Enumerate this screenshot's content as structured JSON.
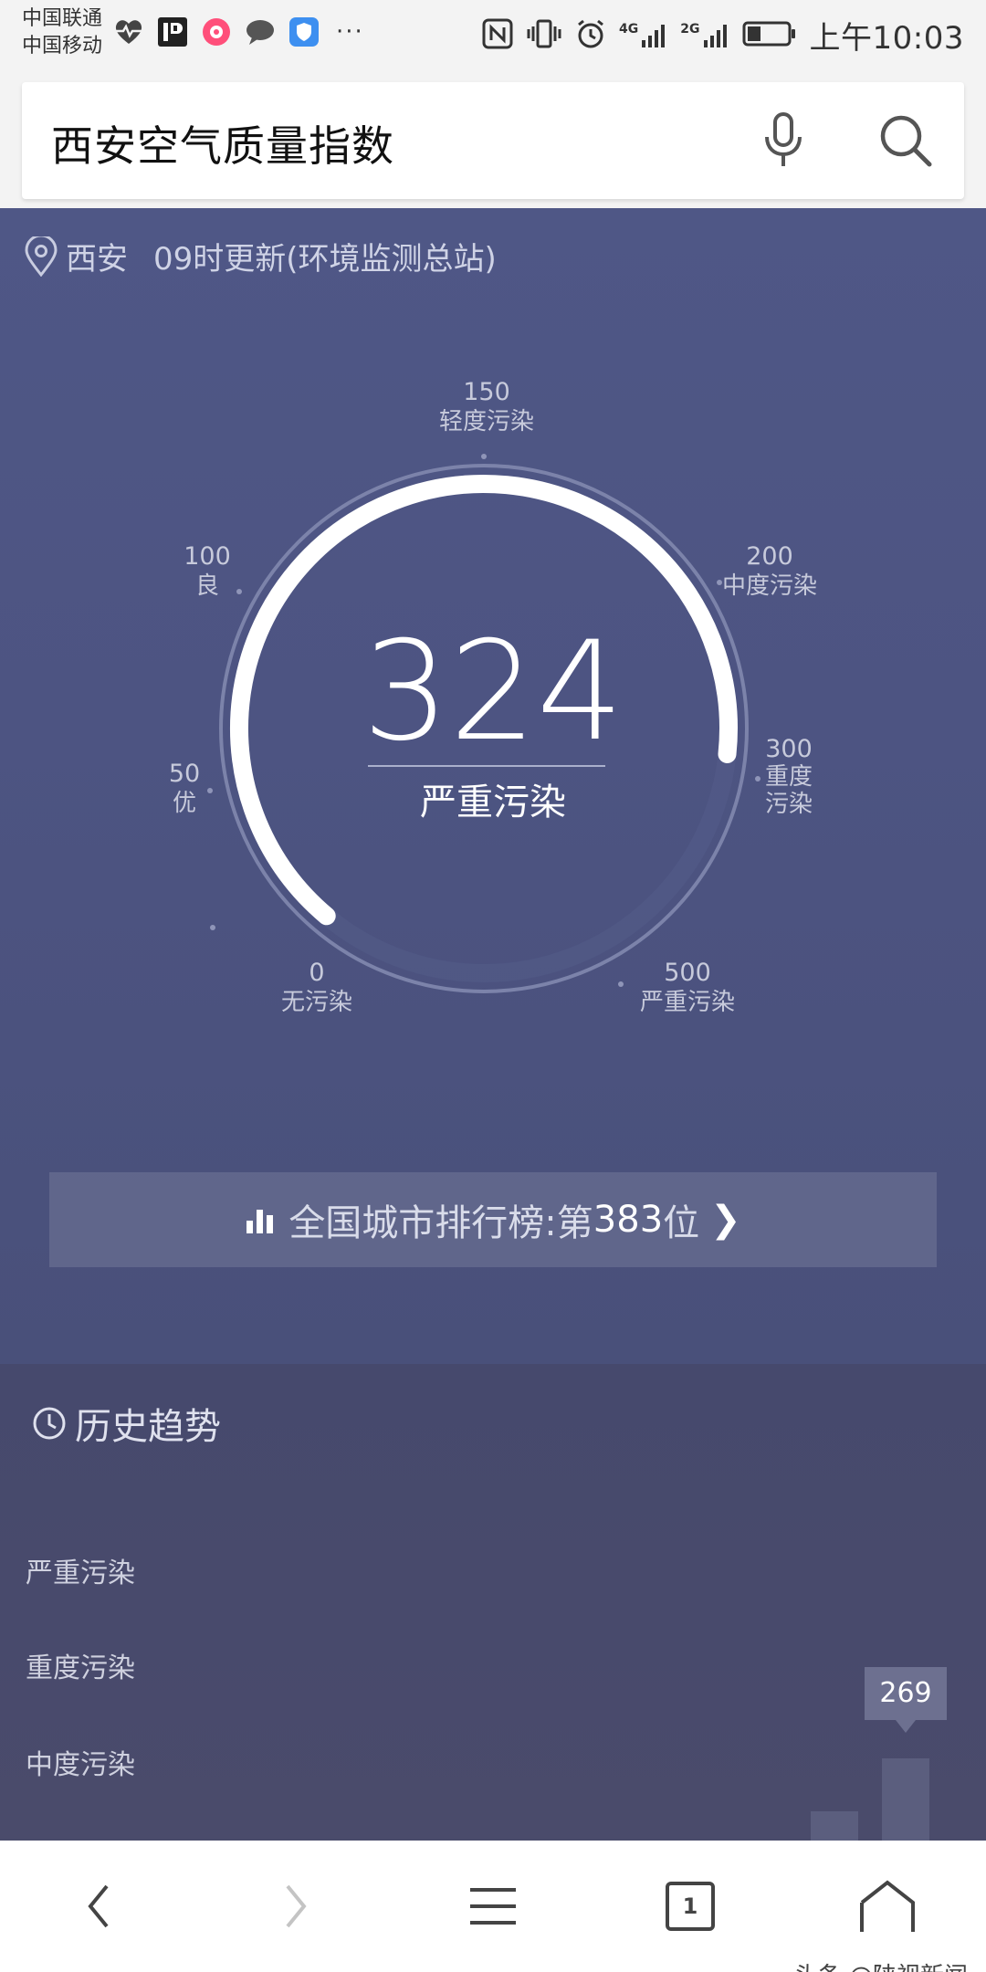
{
  "status_bar": {
    "carrier_1": "中国联通",
    "carrier_2": "中国移动",
    "more": "···",
    "network_1": "4G",
    "network_2": "2G",
    "time": "上午10:03"
  },
  "search": {
    "query": "西安空气质量指数"
  },
  "aqi": {
    "city": "西安",
    "update_info": "09时更新(环境监测总站)",
    "value": "324",
    "level": "严重污染",
    "scale": [
      {
        "value": "0",
        "label": "无污染"
      },
      {
        "value": "50",
        "label": "优"
      },
      {
        "value": "100",
        "label": "良"
      },
      {
        "value": "150",
        "label": "轻度污染"
      },
      {
        "value": "200",
        "label": "中度污染"
      },
      {
        "value": "300",
        "label": "重度污染"
      },
      {
        "value": "500",
        "label": "严重污染"
      }
    ],
    "rank_prefix": "全国城市排行榜:第",
    "rank_number": "383",
    "rank_suffix": "位",
    "rank_chevron": "❯"
  },
  "history": {
    "title": "历史趋势",
    "levels": [
      "严重污染",
      "重度污染",
      "中度污染"
    ],
    "tooltip_value": "269"
  },
  "colors": {
    "card_bg": "#4f5786",
    "arc": "#ffffff",
    "history_bg": "#46496d"
  },
  "nav": {
    "tabs_count": "1"
  },
  "watermark": "头条 @陕视新闻"
}
